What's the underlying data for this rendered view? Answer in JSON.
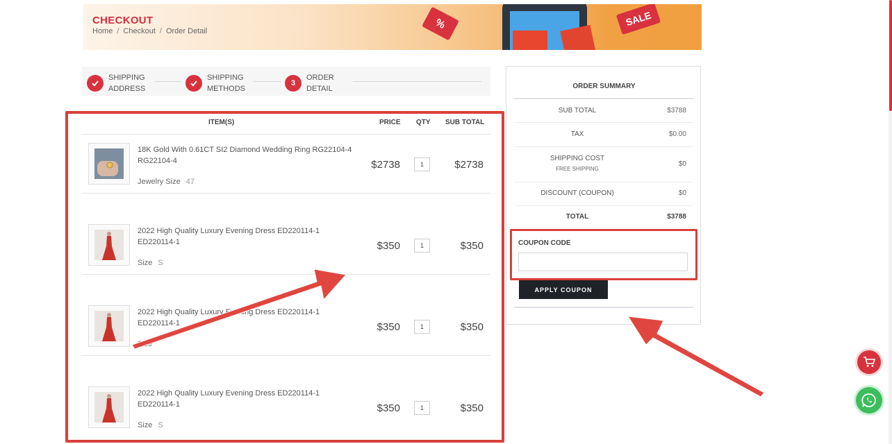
{
  "banner": {
    "title": "CHECKOUT",
    "breadcrumb": [
      "Home",
      "Checkout",
      "Order Detail"
    ],
    "breadcrumb_sep": "/",
    "tag_left": "%",
    "tag_right": "SALE"
  },
  "steps": [
    {
      "label_1": "SHIPPING",
      "label_2": "ADDRESS",
      "state": "done"
    },
    {
      "label_1": "SHIPPING",
      "label_2": "METHODS",
      "state": "done"
    },
    {
      "label_1": "ORDER",
      "label_2": "DETAIL",
      "number": "3",
      "state": "current"
    }
  ],
  "cart": {
    "headers": {
      "items": "ITEM(S)",
      "price": "PRICE",
      "qty": "QTY",
      "subtotal": "SUB TOTAL"
    },
    "rows": [
      {
        "name": "18K Gold With 0.61CT SI2 Diamond Wedding Ring RG22104-4 RG22104-4",
        "attr_label": "Jewelry Size",
        "attr_value": "47",
        "price": "$2738",
        "qty": "1",
        "subtotal": "$2738",
        "thumb": "ring-image"
      },
      {
        "name": "2022 High Quality Luxury Evening Dress ED220114-1 ED220114-1",
        "attr_label": "Size",
        "attr_value": "S",
        "price": "$350",
        "qty": "1",
        "subtotal": "$350",
        "thumb": "dress-image"
      },
      {
        "name": "2022 High Quality Luxury Evening Dress ED220114-1 ED220114-1",
        "attr_label": "Size",
        "attr_value": "",
        "price": "$350",
        "qty": "1",
        "subtotal": "$350",
        "thumb": "dress-image"
      },
      {
        "name": "2022 High Quality Luxury Evening Dress ED220114-1 ED220114-1",
        "attr_label": "Size",
        "attr_value": "S",
        "price": "$350",
        "qty": "1",
        "subtotal": "$350",
        "thumb": "dress-image"
      }
    ]
  },
  "summary": {
    "title": "ORDER SUMMARY",
    "sub_total_label": "SUB TOTAL",
    "sub_total": "$3788",
    "tax_label": "TAX",
    "tax": "$0.00",
    "shipping_label": "SHIPPING COST",
    "shipping_sub": "FREE SHIPPING",
    "shipping": "$0",
    "discount_label": "DISCOUNT (COUPON)",
    "discount": "$0",
    "total_label": "TOTAL",
    "total": "$3788",
    "coupon_label": "COUPON CODE",
    "coupon_value": "",
    "coupon_placeholder": "",
    "apply_label": "APPLY COUPON"
  },
  "colors": {
    "accent": "#d8323f",
    "annotation": "#d8403a",
    "whatsapp": "#3dbd5c",
    "button_dark": "#1f2327"
  },
  "icons": [
    "check-icon",
    "cart-icon",
    "whatsapp-icon"
  ]
}
